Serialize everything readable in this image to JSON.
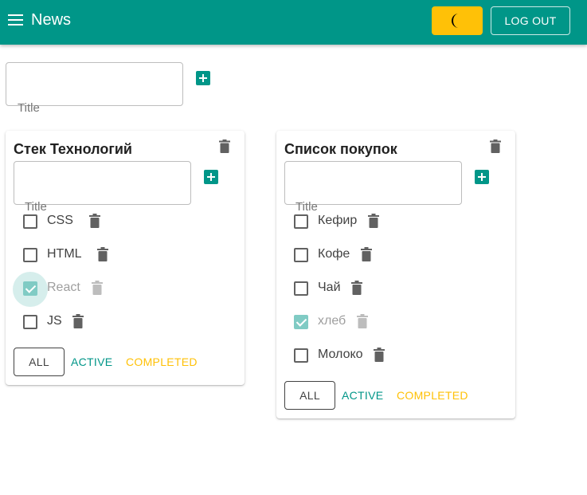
{
  "header": {
    "menu_icon": "hamburger-icon",
    "title": "News",
    "theme_icon": "moon-icon",
    "theme_color": "#ffc107",
    "logout_label": "LOG OUT"
  },
  "add_list": {
    "label": "Title",
    "value": "",
    "add_icon": "plus-square-icon"
  },
  "lists": [
    {
      "title": "Стек Технологий",
      "input_label": "Title",
      "tasks": [
        {
          "label": "CSS",
          "done": false
        },
        {
          "label": "HTML",
          "done": false
        },
        {
          "label": "React",
          "done": true
        },
        {
          "label": "JS",
          "done": false
        }
      ],
      "filters": {
        "all": "ALL",
        "active": "ACTIVE",
        "completed": "COMPLETED"
      }
    },
    {
      "title": "Список покупок",
      "input_label": "Title",
      "tasks": [
        {
          "label": "Кефир",
          "done": false
        },
        {
          "label": "Кофе",
          "done": false
        },
        {
          "label": "Чай",
          "done": false
        },
        {
          "label": "хлеб",
          "done": true
        },
        {
          "label": "Молоко",
          "done": false
        }
      ],
      "filters": {
        "all": "ALL",
        "active": "ACTIVE",
        "completed": "COMPLETED"
      }
    }
  ],
  "colors": {
    "primary": "#009688",
    "secondary": "#ffc107",
    "checked": "#80cbc4",
    "trash": "#616161"
  }
}
